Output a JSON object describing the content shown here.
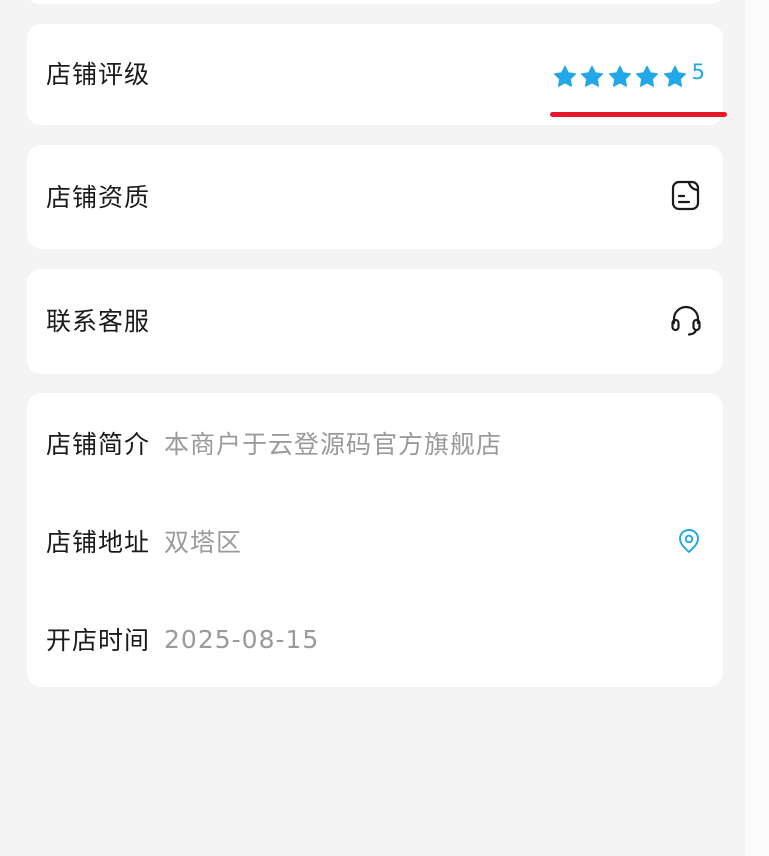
{
  "rating_row": {
    "label": "店铺评级",
    "stars": 5,
    "value": "5",
    "star_color": "#22a7e8",
    "underline_color": "#e8192c"
  },
  "qualification_row": {
    "label": "店铺资质",
    "icon": "document-icon"
  },
  "customer_service_row": {
    "label": "联系客服",
    "icon": "headset-icon"
  },
  "info": {
    "intro": {
      "label": "店铺简介",
      "value": "本商户于云登源码官方旗舰店"
    },
    "address": {
      "label": "店铺地址",
      "value": "双塔区",
      "icon": "location-pin-icon",
      "icon_color": "#22a7e8"
    },
    "open_date": {
      "label": "开店时间",
      "value": "2025-08-15"
    }
  },
  "colors": {
    "background": "#f4f4f4",
    "card": "#ffffff",
    "label_text": "#1a1a1a",
    "value_text": "#9a9a9a"
  }
}
